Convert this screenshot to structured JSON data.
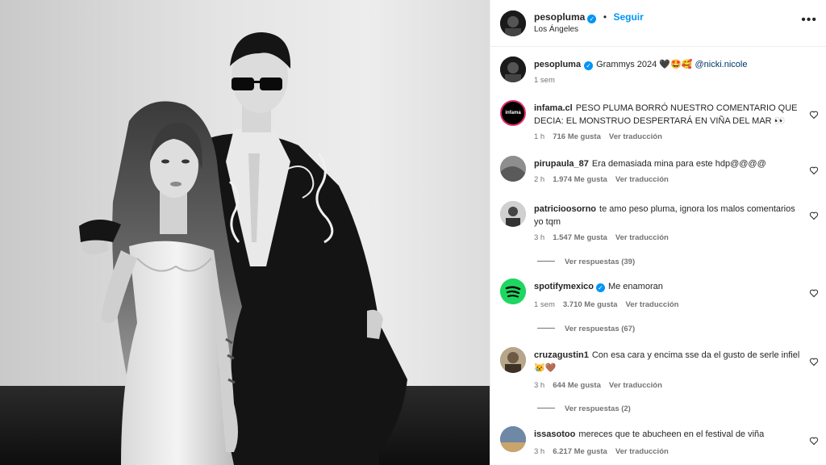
{
  "post": {
    "username": "pesopluma",
    "follow_label": "Seguir",
    "location": "Los Ángeles",
    "more_icon": "more-horizontal-icon",
    "caption_text": "Grammys 2024 🖤🤩🥰",
    "mention": "@nicki.nicole",
    "time": "1 sem"
  },
  "comments": [
    {
      "username": "infama.cl",
      "text": "PESO PLUMA BORRÓ NUESTRO COMENTARIO QUE DECIA: EL MONSTRUO DESPERTARÁ EN VIÑA DEL MAR 👀",
      "time": "1 h",
      "likes": "716 Me gusta",
      "translate": "Ver traducción",
      "avatar_label": "infama"
    },
    {
      "username": "pirupaula_87",
      "text": "Era demasiada mina para este hdp@@@@",
      "time": "2 h",
      "likes": "1.974 Me gusta",
      "translate": "Ver traducción"
    },
    {
      "username": "patricioosorno",
      "text": "te amo peso pluma, ignora los malos comentarios yo tqm",
      "time": "3 h",
      "likes": "1.547 Me gusta",
      "translate": "Ver traducción",
      "replies": "Ver respuestas (39)"
    },
    {
      "username": "spotifymexico",
      "text": "Me enamoran",
      "time": "1 sem",
      "likes": "3.710 Me gusta",
      "translate": "Ver traducción",
      "replies": "Ver respuestas (67)",
      "verified": true
    },
    {
      "username": "cruzagustin1",
      "text": "Con esa cara y encima sse da el gusto de serle infiel 😿🤎",
      "time": "3 h",
      "likes": "644 Me gusta",
      "translate": "Ver traducción",
      "replies": "Ver respuestas (2)"
    },
    {
      "username": "issasotoo",
      "text": "mereces que te abucheen en el festival de viña",
      "time": "3 h",
      "likes": "6.217 Me gusta",
      "translate": "Ver traducción"
    }
  ],
  "colors": {
    "accent": "#0095f6",
    "spotify": "#1ed760",
    "muted": "#737373"
  }
}
